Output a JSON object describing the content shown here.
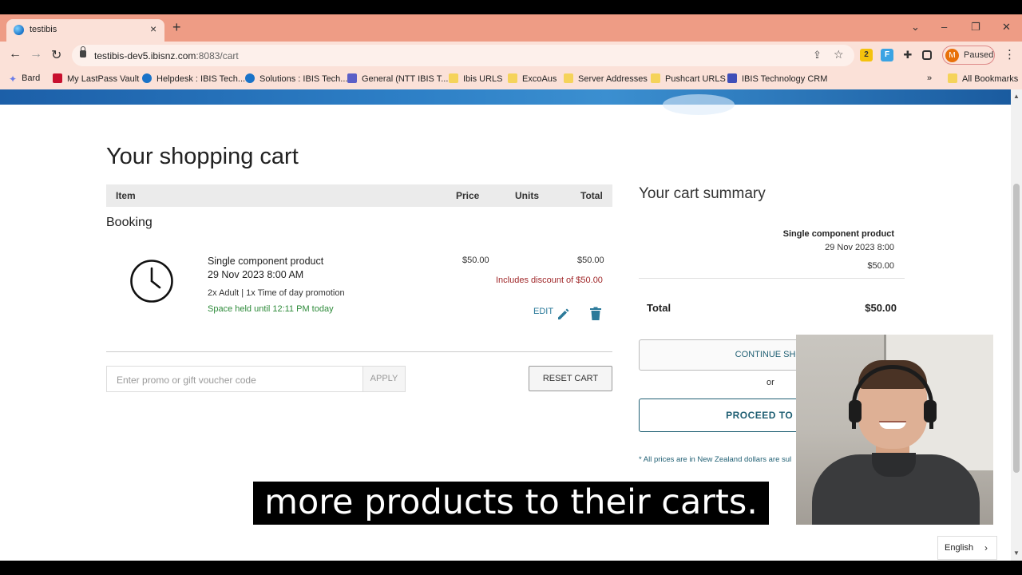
{
  "browser": {
    "tab_title": "testibis",
    "url_host": "testibis-dev5.ibisnz.com",
    "url_path": ":8083/cart",
    "profile_initial": "M",
    "profile_label": "Paused",
    "ext_badge": "2",
    "bookmarks": [
      "Bard",
      "My LastPass Vault",
      "Helpdesk : IBIS Tech...",
      "Solutions : IBIS Tech...",
      "General (NTT IBIS T...",
      "Ibis URLS",
      "ExcoAus",
      "Server Addresses",
      "Pushcart URLS",
      "IBIS Technology CRM"
    ],
    "bookmarks_overflow": "»",
    "all_bookmarks": "All Bookmarks"
  },
  "cart": {
    "title": "Your shopping cart",
    "columns": {
      "item": "Item",
      "price": "Price",
      "units": "Units",
      "total": "Total"
    },
    "section": "Booking",
    "product": {
      "name": "Single component product",
      "date": "29 Nov 2023 8:00 AM",
      "options": "2x Adult | 1x Time of day promotion",
      "held": "Space held until 12:11 PM today",
      "price": "$50.00",
      "total": "$50.00",
      "discount": "Includes discount of $50.00",
      "edit_label": "EDIT"
    },
    "promo_placeholder": "Enter promo or gift voucher code",
    "apply_label": "APPLY",
    "reset_label": "RESET CART"
  },
  "summary": {
    "title": "Your cart summary",
    "item_name": "Single component product",
    "item_date": "29 Nov 2023 8:00",
    "item_price": "$50.00",
    "total_label": "Total",
    "total_value": "$50.00",
    "continue_label": "CONTINUE SHOP",
    "or_label": "or",
    "proceed_label": "PROCEED TO CHE",
    "note": "* All prices are in New Zealand dollars are sul"
  },
  "caption": "more products to their carts.",
  "language": "English",
  "colors": {
    "tab_strip": "#ee9c85",
    "toolbar": "#fbe1d8",
    "accent": "#1f5f73",
    "held_green": "#2e8b3a",
    "discount_red": "#a0282a"
  }
}
